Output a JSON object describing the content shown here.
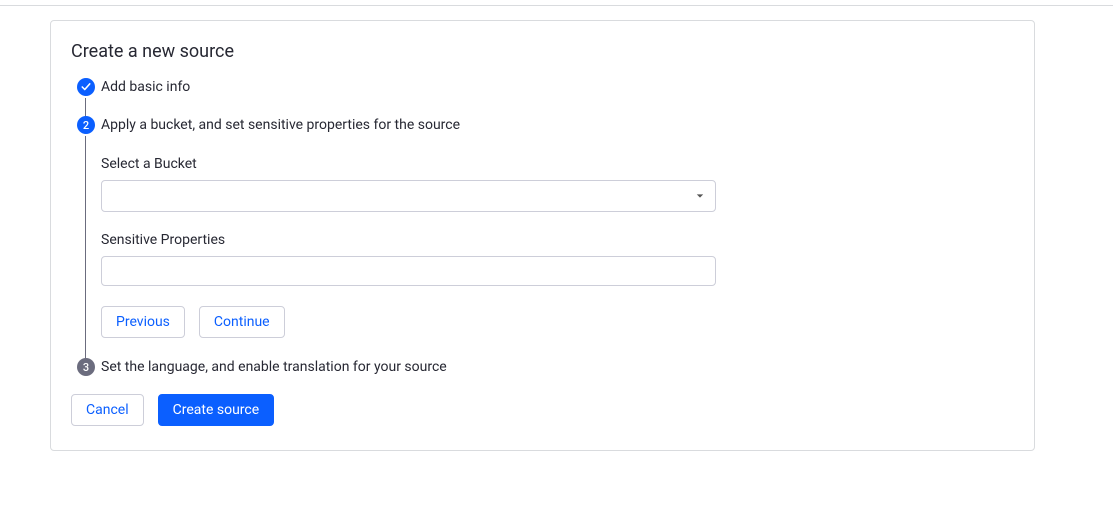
{
  "page": {
    "title": "Create a new source"
  },
  "steps": {
    "step1": {
      "label": "Add basic info",
      "number": "1"
    },
    "step2": {
      "label": "Apply a bucket, and set sensitive properties for the source",
      "number": "2",
      "form": {
        "bucket_label": "Select a Bucket",
        "bucket_value": "",
        "sensitive_label": "Sensitive Properties",
        "sensitive_value": "",
        "previous_label": "Previous",
        "continue_label": "Continue"
      }
    },
    "step3": {
      "label": "Set the language, and enable translation for your source",
      "number": "3"
    }
  },
  "footer": {
    "cancel_label": "Cancel",
    "create_label": "Create source"
  }
}
